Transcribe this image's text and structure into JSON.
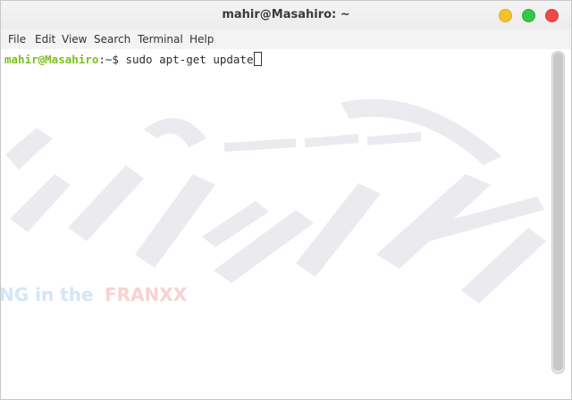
{
  "window": {
    "title": "mahir@Masahiro: ~",
    "buttons": {
      "minimize_color": "#f5c22a",
      "maximize_color": "#35c84a",
      "close_color": "#f0484a"
    }
  },
  "menubar": {
    "items": [
      "File",
      "Edit",
      "View",
      "Search",
      "Terminal",
      "Help"
    ]
  },
  "terminal": {
    "prompt_user": "mahir@Masahiro",
    "prompt_sep": ":",
    "prompt_dir": "~",
    "prompt_symbol": "$ ",
    "command": "sudo apt-get update",
    "user_color": "#7bbf1f",
    "dir_color": "#3d6fb0"
  },
  "background": {
    "watermark_text_1": "NG in the ",
    "watermark_text_2": "FRANXX"
  }
}
